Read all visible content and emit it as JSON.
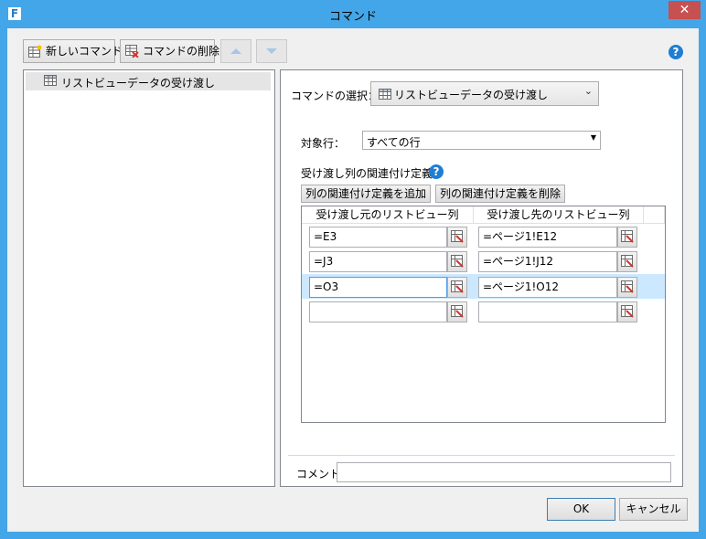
{
  "window": {
    "title": "コマンド",
    "app_icon_letter": "F",
    "close_glyph": "✕"
  },
  "toolbar": {
    "new_command_label": "新しいコマンド",
    "delete_command_label": "コマンドの削除",
    "move_up_glyph": "▲",
    "move_down_glyph": "▼"
  },
  "help_glyph": "?",
  "command_list": {
    "items": [
      {
        "label": "リストビューデータの受け渡し",
        "icon": "grid-icon"
      }
    ]
  },
  "command_select": {
    "label": "コマンドの選択：",
    "value": "リストビューデータの受け渡し",
    "chevron": "⌄"
  },
  "target_row": {
    "label": "対象行：",
    "value": "すべての行"
  },
  "mapping": {
    "section_label": "受け渡し列の関連付け定義",
    "add_button_label": "列の関連付け定義を追加",
    "delete_button_label": "列の関連付け定義を削除",
    "columns": [
      "受け渡し元のリストビュー列",
      "受け渡し先のリストビュー列"
    ],
    "rows": [
      {
        "source": "=E3",
        "target": "=ページ1!E12",
        "selected": false
      },
      {
        "source": "=J3",
        "target": "=ページ1!J12",
        "selected": false
      },
      {
        "source": "=O3",
        "target": "=ページ1!O12",
        "selected": true
      },
      {
        "source": "",
        "target": "",
        "selected": false
      }
    ]
  },
  "comment": {
    "label": "コメント",
    "value": ""
  },
  "dialog_buttons": {
    "ok_label": "OK",
    "cancel_label": "キャンセル"
  },
  "colors": {
    "accent": "#43a6e8",
    "selection": "#cce8ff",
    "close": "#c75050",
    "help": "#1e7ed4"
  }
}
